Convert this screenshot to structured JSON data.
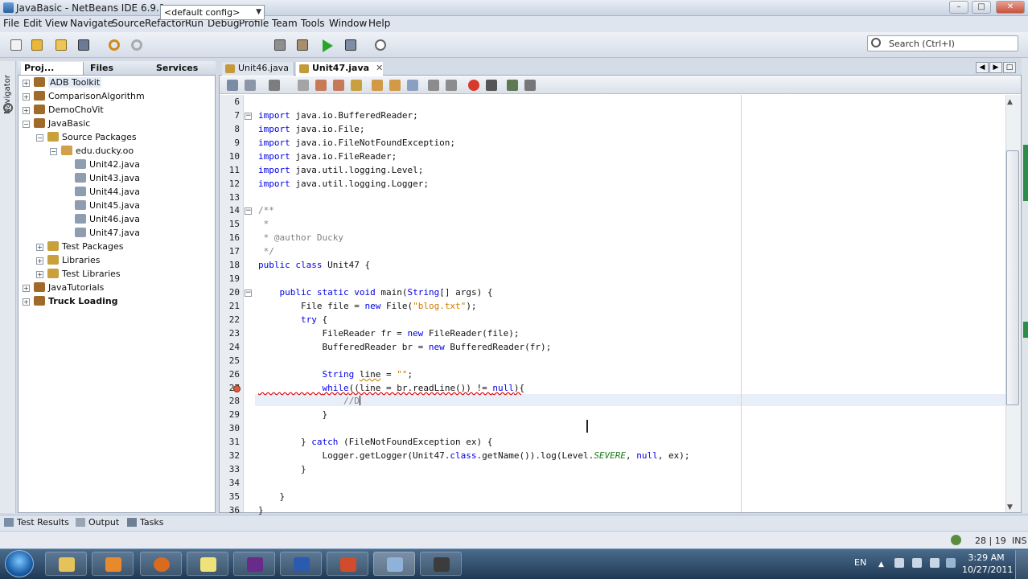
{
  "window": {
    "title": "JavaBasic - NetBeans IDE 6.9.1"
  },
  "menu": [
    "File",
    "Edit",
    "View",
    "Navigate",
    "Source",
    "Refactor",
    "Run",
    "Debug",
    "Profile",
    "Team",
    "Tools",
    "Window",
    "Help"
  ],
  "toolbar": {
    "config_value": "<default config>",
    "search_placeholder": "Search (Ctrl+I)"
  },
  "navigator_label": "Navigator",
  "project_tabs": [
    "Proj...",
    "Files",
    "Services"
  ],
  "tree": [
    {
      "label": "ADB Toolkit",
      "level": 0,
      "bold": false,
      "selected": true
    },
    {
      "label": "ComparisonAlgorithm",
      "level": 0,
      "bold": false
    },
    {
      "label": "DemoChoVit",
      "level": 0,
      "bold": false
    },
    {
      "label": "JavaBasic",
      "level": 0,
      "bold": false
    },
    {
      "label": "Source Packages",
      "level": 1,
      "bold": false
    },
    {
      "label": "edu.ducky.oo",
      "level": 2,
      "bold": false
    },
    {
      "label": "Unit42.java",
      "level": 3,
      "bold": false
    },
    {
      "label": "Unit43.java",
      "level": 3,
      "bold": false
    },
    {
      "label": "Unit44.java",
      "level": 3,
      "bold": false
    },
    {
      "label": "Unit45.java",
      "level": 3,
      "bold": false
    },
    {
      "label": "Unit46.java",
      "level": 3,
      "bold": false
    },
    {
      "label": "Unit47.java",
      "level": 3,
      "bold": false
    },
    {
      "label": "Test Packages",
      "level": 1,
      "bold": false
    },
    {
      "label": "Libraries",
      "level": 1,
      "bold": false
    },
    {
      "label": "Test Libraries",
      "level": 1,
      "bold": false
    },
    {
      "label": "JavaTutorials",
      "level": 0,
      "bold": false
    },
    {
      "label": "Truck Loading",
      "level": 0,
      "bold": true
    }
  ],
  "editor_tabs": [
    {
      "label": "Unit46.java",
      "active": false
    },
    {
      "label": "Unit47.java",
      "active": true
    }
  ],
  "code_lines": [
    {
      "n": "6",
      "t": ""
    },
    {
      "n": "7",
      "t": "import java.io.BufferedReader;"
    },
    {
      "n": "8",
      "t": "import java.io.File;"
    },
    {
      "n": "9",
      "t": "import java.io.FileNotFoundException;"
    },
    {
      "n": "10",
      "t": "import java.io.FileReader;"
    },
    {
      "n": "11",
      "t": "import java.util.logging.Level;"
    },
    {
      "n": "12",
      "t": "import java.util.logging.Logger;"
    },
    {
      "n": "13",
      "t": ""
    },
    {
      "n": "14",
      "t": "/**"
    },
    {
      "n": "15",
      "t": " *"
    },
    {
      "n": "16",
      "t": " * @author Ducky"
    },
    {
      "n": "17",
      "t": " */"
    },
    {
      "n": "18",
      "t": "public class Unit47 {"
    },
    {
      "n": "19",
      "t": ""
    },
    {
      "n": "20",
      "t": "    public static void main(String[] args) {"
    },
    {
      "n": "21",
      "t": "        File file = new File(\"blog.txt\");"
    },
    {
      "n": "22",
      "t": "        try {"
    },
    {
      "n": "23",
      "t": "            FileReader fr = new FileReader(file);"
    },
    {
      "n": "24",
      "t": "            BufferedReader br = new BufferedReader(fr);"
    },
    {
      "n": "25",
      "t": ""
    },
    {
      "n": "26",
      "t": "            String line = \"\";"
    },
    {
      "n": "27",
      "t": "            while((line = br.readLine()) != null){"
    },
    {
      "n": "28",
      "t": "                //D"
    },
    {
      "n": "29",
      "t": "            }"
    },
    {
      "n": "30",
      "t": ""
    },
    {
      "n": "31",
      "t": "        } catch (FileNotFoundException ex) {"
    },
    {
      "n": "32",
      "t": "            Logger.getLogger(Unit47.class.getName()).log(Level.SEVERE, null, ex);"
    },
    {
      "n": "33",
      "t": "        }"
    },
    {
      "n": "34",
      "t": ""
    },
    {
      "n": "35",
      "t": "    }"
    },
    {
      "n": "36",
      "t": "}"
    }
  ],
  "output_tabs": [
    "Test Results",
    "Output",
    "Tasks"
  ],
  "status": {
    "position": "28 | 19",
    "mode": "INS"
  },
  "taskbar": {
    "language": "EN",
    "time": "3:29 AM",
    "date": "10/27/2011"
  }
}
